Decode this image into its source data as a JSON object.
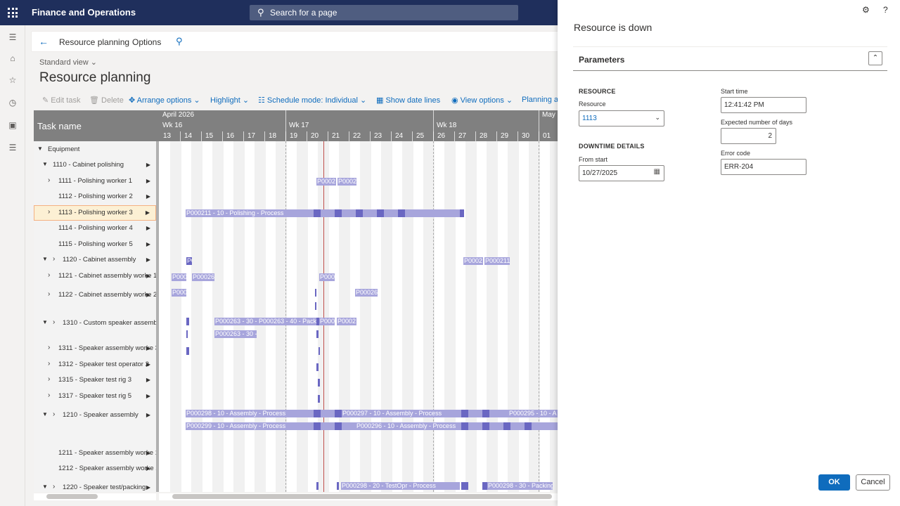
{
  "app": {
    "title": "Finance and Operations",
    "search_placeholder": "Search for a page"
  },
  "breadcrumb": {
    "items": [
      "Resource planning",
      "Options"
    ]
  },
  "page": {
    "view": "Standard view",
    "title": "Resource planning"
  },
  "toolbar": {
    "edit_task": "Edit task",
    "delete": "Delete",
    "arrange": "Arrange options",
    "highlight": "Highlight",
    "schedule_mode": "Schedule mode: Individual",
    "date_lines": "Show date lines",
    "view_options": "View options",
    "planning": "Planning a"
  },
  "gantt": {
    "task_name_header": "Task name",
    "months": [
      "April 2026",
      "May"
    ],
    "weeks": [
      "Wk 16",
      "Wk 17",
      "Wk 18"
    ],
    "days": [
      "13",
      "14",
      "15",
      "16",
      "17",
      "18",
      "19",
      "20",
      "21",
      "22",
      "23",
      "24",
      "25",
      "26",
      "27",
      "28",
      "29",
      "30",
      "01"
    ],
    "rows": [
      {
        "label": "Equipment"
      },
      {
        "label": "1110 - Cabinet polishing"
      },
      {
        "label": "1111 - Polishing worker 1"
      },
      {
        "label": "1112 - Polishing worker 2"
      },
      {
        "label": "1113 - Polishing worker 3"
      },
      {
        "label": "1114 - Polishing worker 4"
      },
      {
        "label": "1115 - Polishing worker 5"
      },
      {
        "label": "1120 - Cabinet assembly"
      },
      {
        "label": "1121 - Cabinet assembly worke 1"
      },
      {
        "label": "1122 - Cabinet assembly worke 2"
      },
      {
        "label": "1310 - Custom speaker assembly"
      },
      {
        "label": "1311 - Speaker assembly worke 3"
      },
      {
        "label": "1312 - Speaker test operator 2"
      },
      {
        "label": "1315 - Speaker test rig 3"
      },
      {
        "label": "1317 - Speaker test rig 5"
      },
      {
        "label": "1210 - Speaker assembly"
      },
      {
        "label": "1211 - Speaker assembly worke 1"
      },
      {
        "label": "1212 - Speaker assembly worke 2"
      },
      {
        "label": "1220 - Speaker test/packing"
      }
    ],
    "bars": {
      "b1": "P0002",
      "b2": "P0002",
      "b3": "P000211 - 10 - Polishing - Process",
      "b4": "P0",
      "b5": "P0002",
      "b6": "P000211",
      "b7": "P000",
      "b8": "P00026",
      "b9": "P000",
      "b10": "P000",
      "b11": "P00026",
      "b12": "P000263 - 30 - P000263 - 40 - Packi",
      "b13": "P000",
      "b14": "P0002",
      "b15": "P000263 - 30 -",
      "b16": "P000298 - 10 - Assembly - Process",
      "b17": "P000297 - 10 - Assembly - Process",
      "b18": "P000295 - 10 - A",
      "b19": "P000299 - 10 - Assembly - Process",
      "b20": "P000296 - 10 - Assembly - Process",
      "b21": "P000298 - 20 - TestOpr - Process",
      "b22": "P000298 - 30 - Packing"
    }
  },
  "panel": {
    "title": "Resource is down",
    "section": "Parameters",
    "resource_group": "RESOURCE",
    "resource_label": "Resource",
    "resource_value": "1113",
    "downtime_group": "DOWNTIME DETAILS",
    "from_start_label": "From start",
    "from_start_value": "10/27/2025",
    "start_time_label": "Start time",
    "start_time_value": "12:41:42 PM",
    "days_label": "Expected number of days",
    "days_value": "2",
    "error_label": "Error code",
    "error_value": "ERR-204",
    "ok": "OK",
    "cancel": "Cancel"
  }
}
